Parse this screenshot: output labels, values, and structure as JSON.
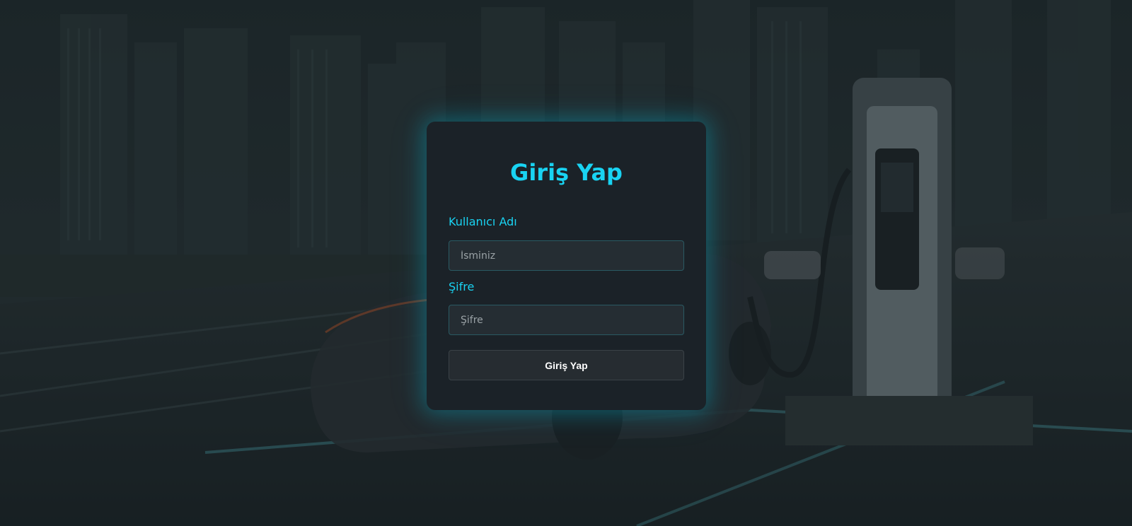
{
  "login": {
    "title": "Giriş Yap",
    "username_label": "Kullanıcı Adı",
    "username_placeholder": "İsminiz",
    "password_label": "Şifre",
    "password_placeholder": "Şifre",
    "submit_label": "Giriş Yap"
  },
  "theme": {
    "accent": "#19d3f2",
    "card_background": "#1b2228",
    "input_background": "#252d33",
    "button_background": "#262c31"
  }
}
